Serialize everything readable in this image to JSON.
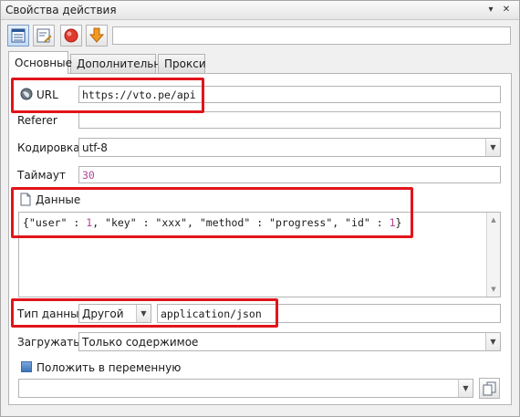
{
  "window": {
    "title": "Свойства действия",
    "pin_icon": "pin-icon",
    "close_icon": "close-icon",
    "toolbar_icons": [
      "table-view-icon",
      "edit-document-icon",
      "stop-record-icon",
      "download-arrow-icon"
    ],
    "toolbar_input_value": ""
  },
  "tabs": [
    {
      "label": "Основные",
      "active": true
    },
    {
      "label": "Дополнительно",
      "active": false
    },
    {
      "label": "Прокси",
      "active": false
    }
  ],
  "url": {
    "icon": "globe-icon",
    "label": "URL",
    "value": "https://vto.pe/api"
  },
  "referer": {
    "label": "Referer",
    "value": ""
  },
  "encoding": {
    "label": "Кодировка",
    "value": "utf-8"
  },
  "timeout": {
    "label": "Таймаут",
    "value": "30"
  },
  "data": {
    "icon": "document-icon",
    "label": "Данные",
    "body_parts": [
      "{\"user\" : ",
      "1",
      ", \"key\" : \"xxx\", \"method\" : \"progress\", \"id\" : ",
      "1",
      "}"
    ]
  },
  "data_type": {
    "label": "Тип данных",
    "select_value": "Другой",
    "value": "application/json"
  },
  "load": {
    "label": "Загружать",
    "value": "Только содержимое"
  },
  "save_to_variable": {
    "label": "Положить в переменную",
    "checked": false,
    "value": ""
  },
  "colors": {
    "highlight": "#e2141b",
    "number": "#b8439a",
    "title_text": "#222222"
  }
}
